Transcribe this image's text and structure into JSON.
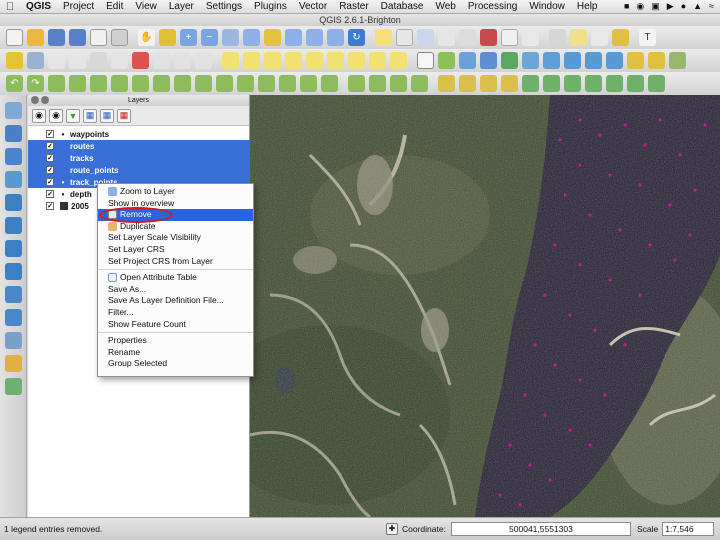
{
  "menubar": {
    "app_name": "QGIS",
    "items": [
      "Project",
      "Edit",
      "View",
      "Layer",
      "Settings",
      "Plugins",
      "Vector",
      "Raster",
      "Database",
      "Web",
      "Processing",
      "Window",
      "Help"
    ]
  },
  "window": {
    "title": "QGIS 2.6.1-Brighton"
  },
  "layers_panel": {
    "title": "Layers",
    "layers": [
      {
        "name": "waypoints",
        "checked": true,
        "selected": false,
        "symbol": "point"
      },
      {
        "name": "routes",
        "checked": true,
        "selected": true,
        "symbol": "line"
      },
      {
        "name": "tracks",
        "checked": true,
        "selected": true,
        "symbol": "line"
      },
      {
        "name": "route_points",
        "checked": true,
        "selected": true,
        "symbol": "point"
      },
      {
        "name": "track_points",
        "checked": true,
        "selected": true,
        "symbol": "point"
      },
      {
        "name": "depth",
        "checked": true,
        "selected": false,
        "symbol": "point"
      },
      {
        "name": "2005",
        "checked": true,
        "selected": false,
        "symbol": "raster"
      }
    ]
  },
  "context_menu": {
    "items": [
      {
        "label": "Zoom to Layer",
        "icon": "zoom-icon"
      },
      {
        "label": "Show in overview",
        "icon": ""
      },
      {
        "label": "Remove",
        "icon": "remove-icon",
        "highlighted": true
      },
      {
        "label": "Duplicate",
        "icon": "duplicate-icon"
      },
      {
        "label": "Set Layer Scale Visibility",
        "icon": ""
      },
      {
        "label": "Set Layer CRS",
        "icon": ""
      },
      {
        "label": "Set Project CRS from Layer",
        "icon": ""
      },
      {
        "label": "Open Attribute Table",
        "icon": "table-icon",
        "separator_before": true
      },
      {
        "label": "Save As...",
        "icon": ""
      },
      {
        "label": "Save As Layer Definition File...",
        "icon": ""
      },
      {
        "label": "Filter...",
        "icon": ""
      },
      {
        "label": "Show Feature Count",
        "icon": ""
      },
      {
        "label": "Properties",
        "icon": "",
        "separator_before": true
      },
      {
        "label": "Rename",
        "icon": ""
      },
      {
        "label": "Group Selected",
        "icon": ""
      }
    ]
  },
  "statusbar": {
    "message": "1 legend entries removed.",
    "coordinate_label": "Coordinate:",
    "coordinate_value": "500041,5551303",
    "scale_label": "Scale",
    "scale_value": "1:7,546"
  },
  "colors": {
    "selection": "#3b6fd8",
    "menu_highlight": "#2a63e0",
    "annotation_ring": "#d21c1c",
    "waypoint": "#c21e8f"
  }
}
